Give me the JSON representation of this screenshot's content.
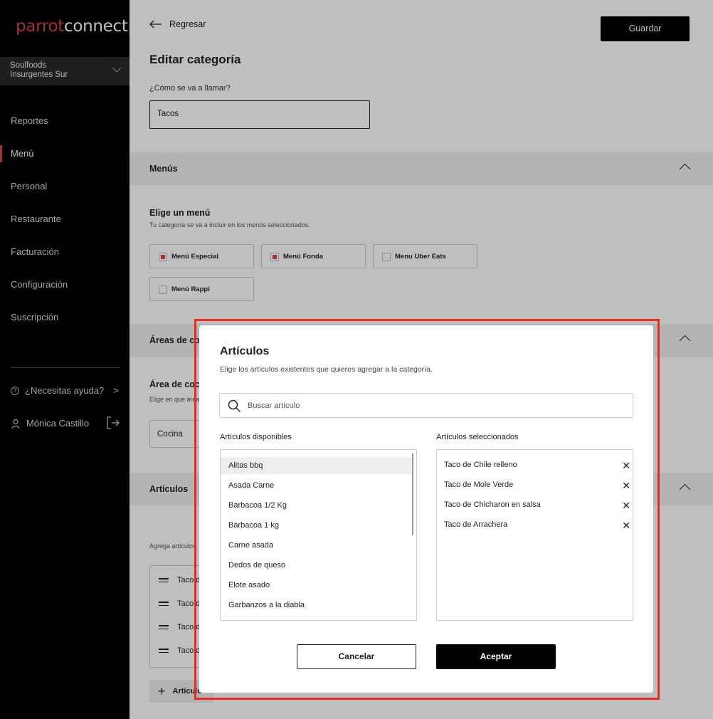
{
  "brand": {
    "logo_part1": "parrot",
    "logo_part2": "connect",
    "accent": "#e0413a"
  },
  "sidebar": {
    "branch": "Soulfoods Insurgentes Sur",
    "items": [
      {
        "label": "Reportes"
      },
      {
        "label": "Menú"
      },
      {
        "label": "Personal"
      },
      {
        "label": "Restaurante"
      },
      {
        "label": "Facturación"
      },
      {
        "label": "Configuración"
      },
      {
        "label": "Suscripción"
      }
    ],
    "help": "¿Necesitas ayuda?",
    "help_arrow": ">",
    "user": "Mónica Castillo"
  },
  "header": {
    "back": "Regresar",
    "save": "Guardar",
    "title": "Editar categoría"
  },
  "name": {
    "label": "¿Cómo se va a llamar?",
    "value": "Tacos"
  },
  "menus": {
    "section": "Menús",
    "title": "Elige un menú",
    "desc": "Tu categoría se va a incluir en los menús seleccionados.",
    "options": [
      {
        "label": "Menú Especial",
        "checked": true
      },
      {
        "label": "Menú Fonda",
        "checked": true
      },
      {
        "label": "Menu Uber Eats",
        "checked": false
      },
      {
        "label": "Menú Rappi",
        "checked": false
      }
    ]
  },
  "areas": {
    "section": "Áreas de cocina",
    "title": "Área de cocina",
    "desc": "Elige en que área",
    "value": "Cocina"
  },
  "articles_section": {
    "section": "Artículos",
    "desc": "Agrega artículos",
    "rows": [
      "Taco d",
      "Taco d",
      "Taco d",
      "Taco d"
    ],
    "add": "Artículo"
  },
  "modal": {
    "title": "Artículos",
    "subtitle": "Elige los artículos existentes que quieres agregar a la categoría.",
    "search_placeholder": "Buscar artículo",
    "available_label": "Artículos disponibles",
    "selected_label": "Artículos seleccionados",
    "available": [
      "Alitas bbq",
      "Asada Carne",
      "Barbacoa 1/2 Kg",
      "Barbacoa 1 kg",
      "Carne asada",
      "Dedos de queso",
      "Elote asado",
      "Garbanzos a la diabla"
    ],
    "selected": [
      "Taco de Chile relleno",
      "Taco de Mole Verde",
      "Taco de Chicharon en salsa",
      "Taco de Arrachera"
    ],
    "remove_glyph": "✕",
    "cancel": "Cancelar",
    "accept": "Aceptar"
  }
}
